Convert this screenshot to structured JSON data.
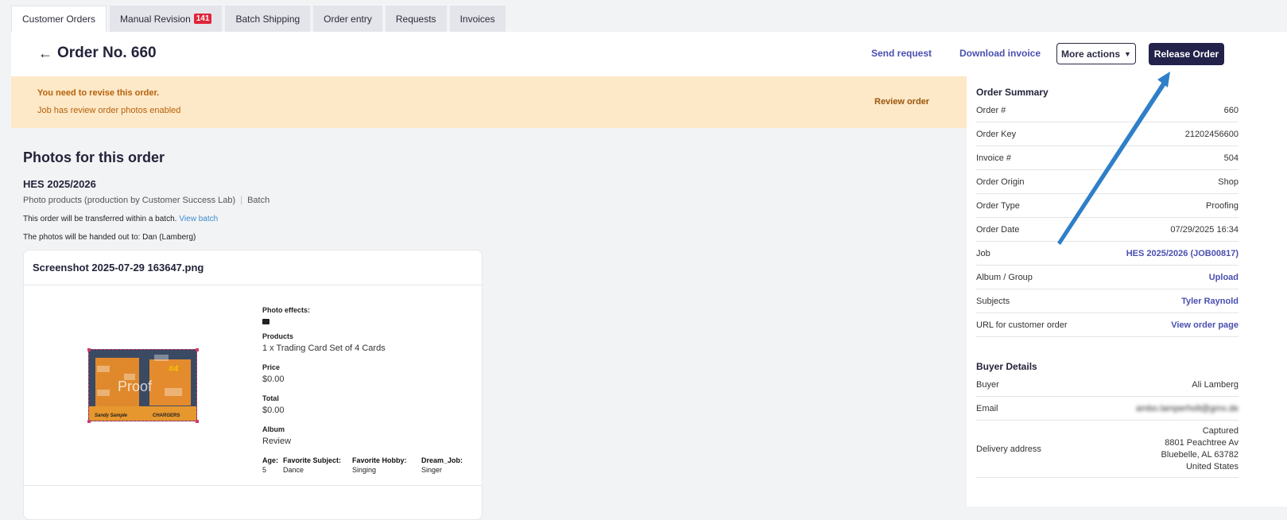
{
  "tabs": [
    {
      "label": "Customer Orders",
      "active": true
    },
    {
      "label": "Manual Revision",
      "badge": "141"
    },
    {
      "label": "Batch Shipping"
    },
    {
      "label": "Order entry"
    },
    {
      "label": "Requests"
    },
    {
      "label": "Invoices"
    }
  ],
  "header": {
    "title": "Order No. 660",
    "send_request": "Send request",
    "download_invoice": "Download invoice",
    "more_actions": "More actions",
    "release_order": "Release Order"
  },
  "banner": {
    "line1": "You need to revise this order.",
    "line2": "Job has review order photos enabled",
    "action": "Review order",
    "bg_color": "#fde8c8"
  },
  "photos": {
    "section_title": "Photos for this order",
    "job_title": "HES 2025/2026",
    "job_product": "Photo products (production by Customer Success Lab)",
    "job_type": "Batch",
    "transfer_text": "This order will be transferred within a batch.",
    "view_batch": "View batch",
    "handed_out": "The photos will be handed out to: Dan (Lamberg)",
    "card": {
      "filename": "Screenshot 2025-07-29 163647.png",
      "thumb_proof": "Proof",
      "thumb_number": "#4",
      "thumb_name": "Sandy Sample",
      "thumb_team": "CHARGERS",
      "photo_effects_label": "Photo effects:",
      "products_label": "Products",
      "products_value": "1 x Trading Card Set of 4 Cards",
      "price_label": "Price",
      "price_value": "$0.00",
      "total_label": "Total",
      "total_value": "$0.00",
      "album_label": "Album",
      "album_value": "Review",
      "attributes": [
        {
          "key": "Age:",
          "value": "5"
        },
        {
          "key": "Favorite Subject:",
          "value": "Dance"
        },
        {
          "key": "Favorite Hobby:",
          "value": "Singing"
        },
        {
          "key": "Dream_Job:",
          "value": "Singer"
        }
      ]
    }
  },
  "summary": {
    "title": "Order Summary",
    "rows": [
      {
        "label": "Order #",
        "value": "660"
      },
      {
        "label": "Order Key",
        "value": "21202456600"
      },
      {
        "label": "Invoice #",
        "value": "504"
      },
      {
        "label": "Order Origin",
        "value": "Shop"
      },
      {
        "label": "Order Type",
        "value": "Proofing"
      },
      {
        "label": "Order Date",
        "value": "07/29/2025 16:34"
      },
      {
        "label": "Job",
        "value": "HES 2025/2026 (JOB00817)"
      },
      {
        "label": "Album / Group",
        "value": "Upload"
      },
      {
        "label": "Subjects",
        "value": "Tyler Raynold"
      },
      {
        "label": "URL for customer order",
        "value": "View order page"
      }
    ]
  },
  "buyer": {
    "title": "Buyer Details",
    "buyer_label": "Buyer",
    "buyer_value": "Ali Lamberg",
    "email_label": "Email",
    "email_value": "ambo.lamperholt@gmx.de",
    "address_label": "Delivery address",
    "address_lines": [
      "Captured",
      "8801 Peachtree Av",
      "Bluebelle, AL 63782",
      "United States"
    ]
  },
  "colors": {
    "accent": "#4a4fb0",
    "primary_button": "#23224a",
    "badge": "#e0253a",
    "banner_text": "#b5620b",
    "annotation_arrow": "#2f7fc8"
  }
}
